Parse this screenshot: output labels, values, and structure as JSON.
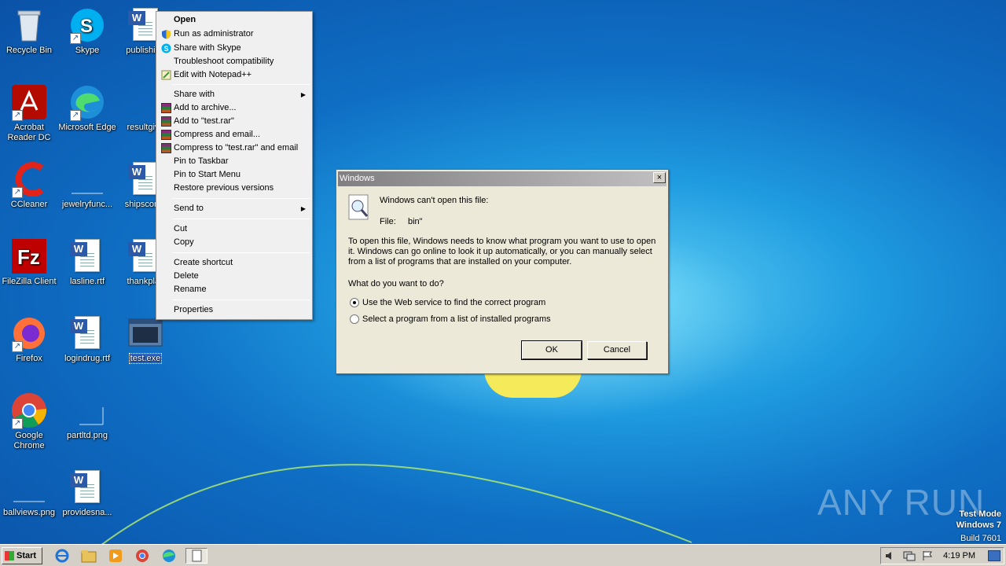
{
  "desktop": {
    "icons": [
      {
        "label": "Recycle Bin"
      },
      {
        "label": "Skype"
      },
      {
        "label": "publishing"
      },
      {
        "label": "Acrobat Reader DC"
      },
      {
        "label": "Microsoft Edge"
      },
      {
        "label": "resultgive"
      },
      {
        "label": "CCleaner"
      },
      {
        "label": "jewelryfunc..."
      },
      {
        "label": "shipscomp"
      },
      {
        "label": "FileZilla Client"
      },
      {
        "label": "lasline.rtf"
      },
      {
        "label": "thankplay"
      },
      {
        "label": "Firefox"
      },
      {
        "label": "logindrug.rtf"
      },
      {
        "label": "test.exe"
      },
      {
        "label": "Google Chrome"
      },
      {
        "label": "partltd.png"
      },
      {
        "label": "ballviews.png"
      },
      {
        "label": "providesna..."
      }
    ]
  },
  "context_menu": {
    "items": [
      {
        "label": "Open",
        "bold": true
      },
      {
        "label": "Run as administrator",
        "icon": "shield-icon"
      },
      {
        "label": "Share with Skype",
        "icon": "skype-icon"
      },
      {
        "label": "Troubleshoot compatibility"
      },
      {
        "label": "Edit with Notepad++",
        "icon": "notepad-icon"
      },
      {
        "label": "Share with",
        "submenu": true
      },
      {
        "label": "Add to archive...",
        "icon": "winrar-icon"
      },
      {
        "label": "Add to \"test.rar\"",
        "icon": "winrar-icon"
      },
      {
        "label": "Compress and email...",
        "icon": "winrar-icon"
      },
      {
        "label": "Compress to \"test.rar\" and email",
        "icon": "winrar-icon"
      },
      {
        "label": "Pin to Taskbar"
      },
      {
        "label": "Pin to Start Menu"
      },
      {
        "label": "Restore previous versions"
      },
      {
        "label": "Send to",
        "submenu": true
      },
      {
        "label": "Cut"
      },
      {
        "label": "Copy"
      },
      {
        "label": "Create shortcut"
      },
      {
        "label": "Delete"
      },
      {
        "label": "Rename"
      },
      {
        "label": "Properties"
      }
    ]
  },
  "dialog": {
    "title": "Windows",
    "close": "×",
    "heading": "Windows can't open this file:",
    "file_label": "File:",
    "file_name": "bin\"",
    "description": "To open this file, Windows needs to know what program you want to use to open it. Windows can go online to look it up automatically, or you can manually select from a list of programs that are installed on your computer.",
    "question": "What do you want to do?",
    "options": [
      {
        "label": "Use the Web service to find the correct program",
        "selected": true
      },
      {
        "label": "Select a program from a list of installed programs",
        "selected": false
      }
    ],
    "ok": "OK",
    "cancel": "Cancel"
  },
  "taskbar": {
    "start": "Start",
    "clock": "4:19 PM"
  },
  "watermark": {
    "brand": "ANY RUN",
    "line1": "Test Mode",
    "line2": "Windows 7",
    "line3": "Build 7601"
  },
  "colors": {
    "selection": "#3169c6",
    "dialog_bg": "#ece9d8",
    "menu_bg": "#f0f0f0"
  }
}
